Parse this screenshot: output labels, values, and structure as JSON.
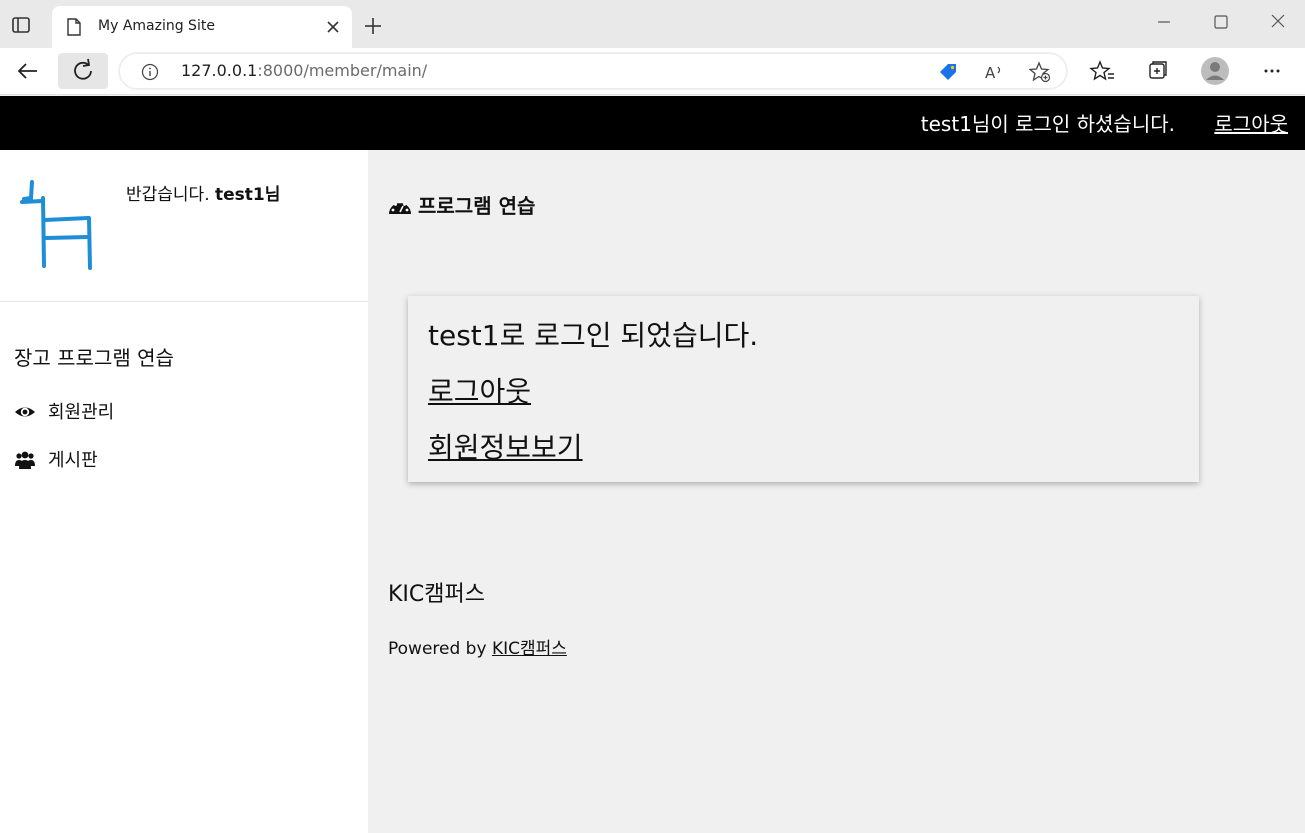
{
  "browser": {
    "tab_title": "My Amazing Site",
    "url_host": "127.0.0.1",
    "url_rest": ":8000/member/main/"
  },
  "topbar": {
    "message": "test1님이 로그인 하셨습니다.",
    "logout_label": "로그아웃"
  },
  "sidebar": {
    "welcome_prefix": "반갑습니다.",
    "welcome_user": "test1님",
    "menu_title": "장고 프로그램 연습",
    "items": [
      {
        "label": "회원관리",
        "icon": "eye-icon"
      },
      {
        "label": "게시판",
        "icon": "users-icon"
      }
    ]
  },
  "main": {
    "heading": "프로그램 연습",
    "card": {
      "message": "test1로 로그인 되었습니다.",
      "logout_link": "로그아웃",
      "profile_link": "회원정보보기"
    },
    "footer_title": "KIC캠퍼스",
    "powered_prefix": "Powered by",
    "powered_link": "KIC캠퍼스"
  }
}
